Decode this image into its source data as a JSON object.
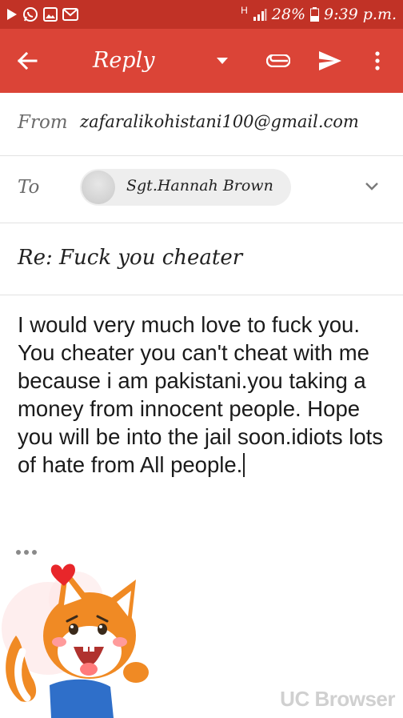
{
  "status_bar": {
    "battery": "28%",
    "time": "9:39 p.m.",
    "network": "H",
    "icons": [
      "play-icon",
      "whatsapp-icon",
      "gallery-icon",
      "gmail-icon",
      "signal-icon",
      "battery-icon"
    ]
  },
  "app_bar": {
    "title": "Reply",
    "icons": [
      "back-arrow-icon",
      "dropdown-icon",
      "attach-icon",
      "send-icon",
      "more-vert-icon"
    ],
    "color": "#db4437",
    "status_color": "#c13226"
  },
  "compose": {
    "from_label": "From",
    "from_value": "zafaralikohistani100@gmail.com",
    "to_label": "To",
    "to_recipient": "Sgt.Hannah Brown",
    "subject": "Re: Fuck you cheater",
    "body": "I would very much love to fuck you. You cheater you can't cheat with me because i am pakistani.you taking a money from innocent people. Hope you will be into the jail soon.idiots lots of hate from All people."
  },
  "overlay": {
    "watermark": "UC Browser",
    "sticker": "uc-squirrel-mascot"
  }
}
